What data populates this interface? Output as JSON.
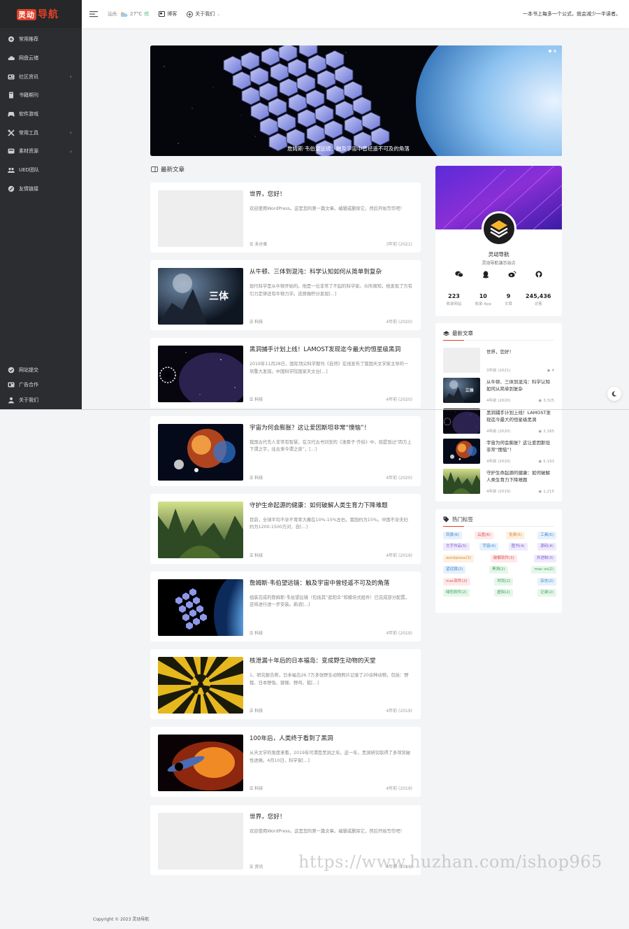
{
  "brand": {
    "logo_box": "灵动",
    "logo_rest": "导航",
    "accent": "#e0402a"
  },
  "sidebar": {
    "items": [
      {
        "label": "常用推荐",
        "icon": "recommend-icon"
      },
      {
        "label": "网盘云储",
        "icon": "cloud-icon"
      },
      {
        "label": "社区资讯",
        "icon": "news-icon",
        "has_sub": true
      },
      {
        "label": "书籍期刊",
        "icon": "book-icon"
      },
      {
        "label": "软件游戏",
        "icon": "gamepad-icon"
      },
      {
        "label": "常用工具",
        "icon": "tools-icon",
        "has_sub": true
      },
      {
        "label": "素材资源",
        "icon": "material-icon",
        "has_sub": true
      },
      {
        "label": "UED团队",
        "icon": "team-icon"
      },
      {
        "label": "友情链接",
        "icon": "link-icon"
      }
    ],
    "bottom_items": [
      {
        "label": "网站提交",
        "icon": "check-circle-icon"
      },
      {
        "label": "广告合作",
        "icon": "ad-icon"
      },
      {
        "label": "关于我们",
        "icon": "users-icon"
      }
    ]
  },
  "header": {
    "city": "汕头",
    "temp": "27°C",
    "aqi": "优",
    "blog_label": "博客",
    "about_label": "关于我们",
    "motto": "一本书上每多一个公式，就会减少一半读者。"
  },
  "banner": {
    "caption": "詹姆斯·韦伯望远镜：触及宇宙中曾经遥不可及的角落"
  },
  "latest_title": "最新文章",
  "posts": [
    {
      "title": "世界，您好！",
      "excerpt": "欢迎使用WordPress。这是您的第一篇文章。编辑或删除它，然后开始写作吧！",
      "cat": "未分类",
      "date": "3年前 (2021)",
      "thumb": "blank"
    },
    {
      "title": "从牛顿、三体到混沌：科学认知如何从简单到复杂",
      "excerpt": "现代科学是从牛顿开始的。他是一位非常了不起的科学家。众所周知，他发现了万有引力定律还有牛顿力学。还原做积分发现[...]",
      "cat": "科技",
      "date": "4年前 (2020)",
      "thumb": "santi"
    },
    {
      "title": "黑洞捕手计划上线！LAMOST发现迄今最大的恒星级黑洞",
      "excerpt": "2019年11月28日，国际顶尖科学期刊《自然》在线发布了我国天文学家主导的一项重大发现。中国科学院国家天文台[...]",
      "cat": "科技",
      "date": "4年前 (2020)",
      "thumb": "blackhole"
    },
    {
      "title": "宇宙为何会膨胀？这让爱因斯坦非常“懊恼”！",
      "excerpt": "我国古代先人非常有智慧，在汉代古书刘安的《淮南子·齐俗》中，就提到过“四方上下谓之宇，往古来今谓之宙”，[...]",
      "cat": "科技",
      "date": "4年前 (2020)",
      "thumb": "cosmos"
    },
    {
      "title": "守护生命起源的健康：如何破解人类生育力下降难题",
      "excerpt": "目前，全球平均不孕不育率大概在10%-15%左右，我国约为15%。中国不孕夫妇约为1200-1500万对，自[...]",
      "cat": "科技",
      "date": "4年前 (2019)",
      "thumb": "forest"
    },
    {
      "title": "詹姆斯·韦伯望远镜：触及宇宙中曾经遥不可及的角落",
      "excerpt": "组装完成的詹姆斯·韦伯望远镜（包括其“遮阳伞”和模块式组件）已完成部分配置，还将进行进一步安装。新浪[...]",
      "cat": "科技",
      "date": "4年前 (2019)",
      "thumb": "webb"
    },
    {
      "title": "核泄漏十年后的日本福岛：变成野生动物的天堂",
      "excerpt": "1、研究报告称，日本福岛26.7万多张野生动物照片记录了20余种动物，包括：野猪、日本野兔、猕猴、野鸡、狐[...]",
      "cat": "科技",
      "date": "4年前 (2019)",
      "thumb": "radiation"
    },
    {
      "title": "100年后，人类终于看到了黑洞",
      "excerpt": "从天文学的角度来看，2019年可谓是黑洞之年。这一年，黑洞研究取得了多项突破性进展。4月10日，科学家[...]",
      "cat": "科技",
      "date": "4年前 (2019)",
      "thumb": "blackhole2"
    },
    {
      "title": "世界，您好！",
      "excerpt": "欢迎使用WordPress。这是您的第一篇文章。编辑或删除它，然后开始写作吧！",
      "cat": "资讯",
      "date": "4年前 (2019)",
      "thumb": "blank"
    }
  ],
  "profile": {
    "name": "灵动导航",
    "desc": "灵动导航演示站点",
    "socials": [
      "wechat-icon",
      "qq-icon",
      "weibo-icon",
      "github-icon"
    ],
    "stats": [
      {
        "num": "223",
        "label": "收录网站"
      },
      {
        "num": "10",
        "label": "收录 App"
      },
      {
        "num": "9",
        "label": "文章"
      },
      {
        "num": "245,436",
        "label": "访客"
      }
    ]
  },
  "latest_widget": {
    "title": "最新文章",
    "items": [
      {
        "title": "世界，您好！",
        "date": "3年前 (2021)",
        "views": "4",
        "thumb": "blank"
      },
      {
        "title": "从牛顿、三体到混沌：科学认知如何从简单到复杂",
        "date": "4年前 (2020)",
        "views": "3,325",
        "thumb": "santi"
      },
      {
        "title": "黑洞捕手计划上线！LAMOST发现迄今最大的恒星级黑洞",
        "date": "4年前 (2020)",
        "views": "2,185",
        "thumb": "blackhole"
      },
      {
        "title": "宇宙为何会膨胀？这让爱因斯坦非常“懊恼”！",
        "date": "4年前 (2020)",
        "views": "5,193",
        "thumb": "cosmos"
      },
      {
        "title": "守护生命起源的健康：如何破解人类生育力下降难题",
        "date": "4年前 (2019)",
        "views": "1,215",
        "thumb": "forest"
      }
    ]
  },
  "hot_tags": {
    "title": "热门标签",
    "rows": [
      [
        {
          "t": "风景(6)",
          "c": "blue"
        },
        {
          "t": "云盘(6)",
          "c": "red"
        },
        {
          "t": "免费(5)",
          "c": "orange"
        },
        {
          "t": "工具(5)",
          "c": "blue"
        }
      ],
      [
        {
          "t": "文字作品(5)",
          "c": "purple"
        },
        {
          "t": "宇宙(4)",
          "c": "blue"
        },
        {
          "t": "图书(4)",
          "c": "purple"
        },
        {
          "t": "源码(4)",
          "c": "purple"
        }
      ],
      [
        {
          "t": "wordpress(3)",
          "c": "orange"
        },
        {
          "t": "破解软件(3)",
          "c": "red"
        },
        {
          "t": "并进制(3)",
          "c": "purple"
        }
      ],
      [
        {
          "t": "望远镜(2)",
          "c": "blue"
        },
        {
          "t": "黑洞(2)",
          "c": "green"
        },
        {
          "t": "mac os(2)",
          "c": "green"
        }
      ],
      [
        {
          "t": "mac软件(2)",
          "c": "red"
        },
        {
          "t": "时尚(2)",
          "c": "green"
        },
        {
          "t": "杂志(2)",
          "c": "blue"
        }
      ],
      [
        {
          "t": "绿色软件(2)",
          "c": "green"
        },
        {
          "t": "虚拟(2)",
          "c": "green"
        },
        {
          "t": "记录(2)",
          "c": "green"
        }
      ]
    ]
  },
  "footer": "Copyright © 2023 灵动导航",
  "watermark": "https://www.huzhan.com/ishop965"
}
